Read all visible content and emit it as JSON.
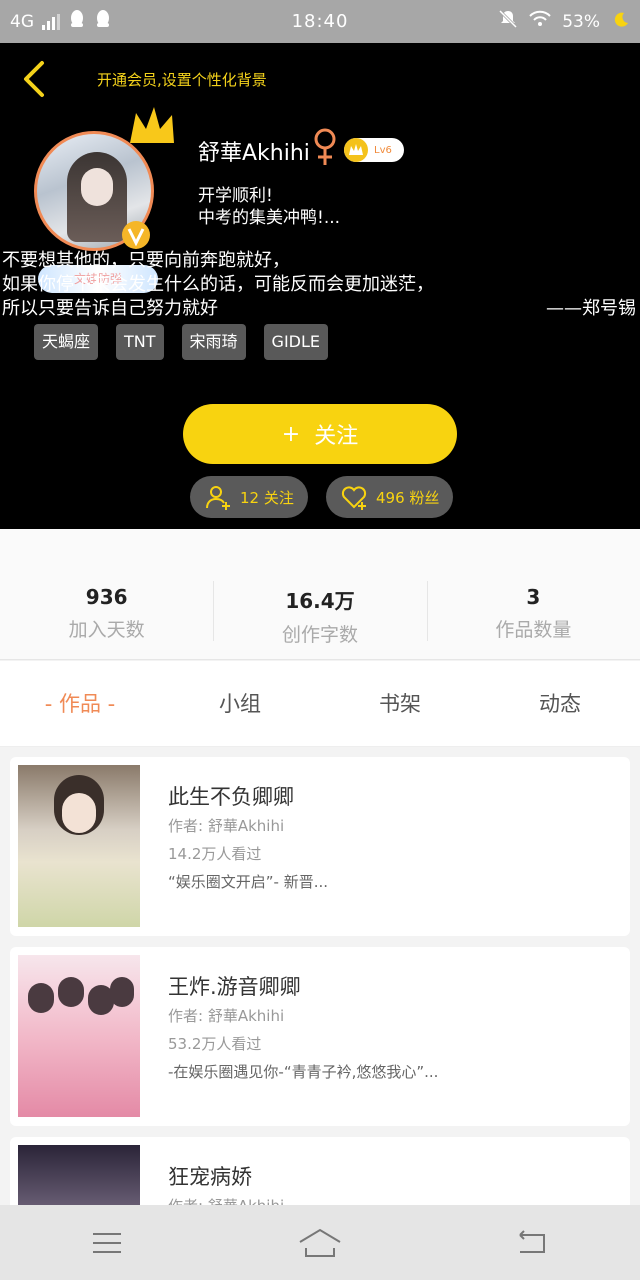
{
  "status_bar": {
    "network": "4G",
    "time": "18:40",
    "battery": "53%"
  },
  "header": {
    "vip_tip": "开通会员,设置个性化背景",
    "avatar_ribbon": "文娃防弹",
    "username": "舒華Akhihi",
    "level": "Lv6",
    "signature_lines": [
      "开学顺利!",
      "中考的集美冲鸭!..."
    ],
    "quote_lines": [
      "不要想其他的，只要向前奔跑就好，",
      "如果你停下来会发生什么的话，可能反而会更加迷茫，",
      "所以只要告诉自己努力就好"
    ],
    "quote_author": "——郑号锡",
    "tags": [
      "天蝎座",
      "TNT",
      "宋雨琦",
      "GIDLE"
    ],
    "follow_button": "关注",
    "following_count": "12 关注",
    "fans_count": "496 粉丝"
  },
  "stats": [
    {
      "value": "936",
      "label": "加入天数"
    },
    {
      "value": "16.4万",
      "label": "创作字数"
    },
    {
      "value": "3",
      "label": "作品数量"
    }
  ],
  "tabs": [
    "- 作品 -",
    "小组",
    "书架",
    "动态"
  ],
  "works": [
    {
      "title": "此生不负卿卿",
      "author": "作者: 舒華Akhihi",
      "views": "14.2万人看过",
      "desc": "“娱乐圈文开启”- 新晋..."
    },
    {
      "title": "王炸.游音卿卿",
      "author": "作者: 舒華Akhihi",
      "views": "53.2万人看过",
      "desc": "-在娱乐圈遇见你-“青青子衿,悠悠我心”..."
    },
    {
      "title": "狂宠病娇",
      "author": "作者: 舒華Akhihi",
      "views": "",
      "desc": ""
    }
  ],
  "colors": {
    "accent_yellow": "#f8d310",
    "accent_orange": "#f08a55",
    "header_bg": "#000000"
  }
}
